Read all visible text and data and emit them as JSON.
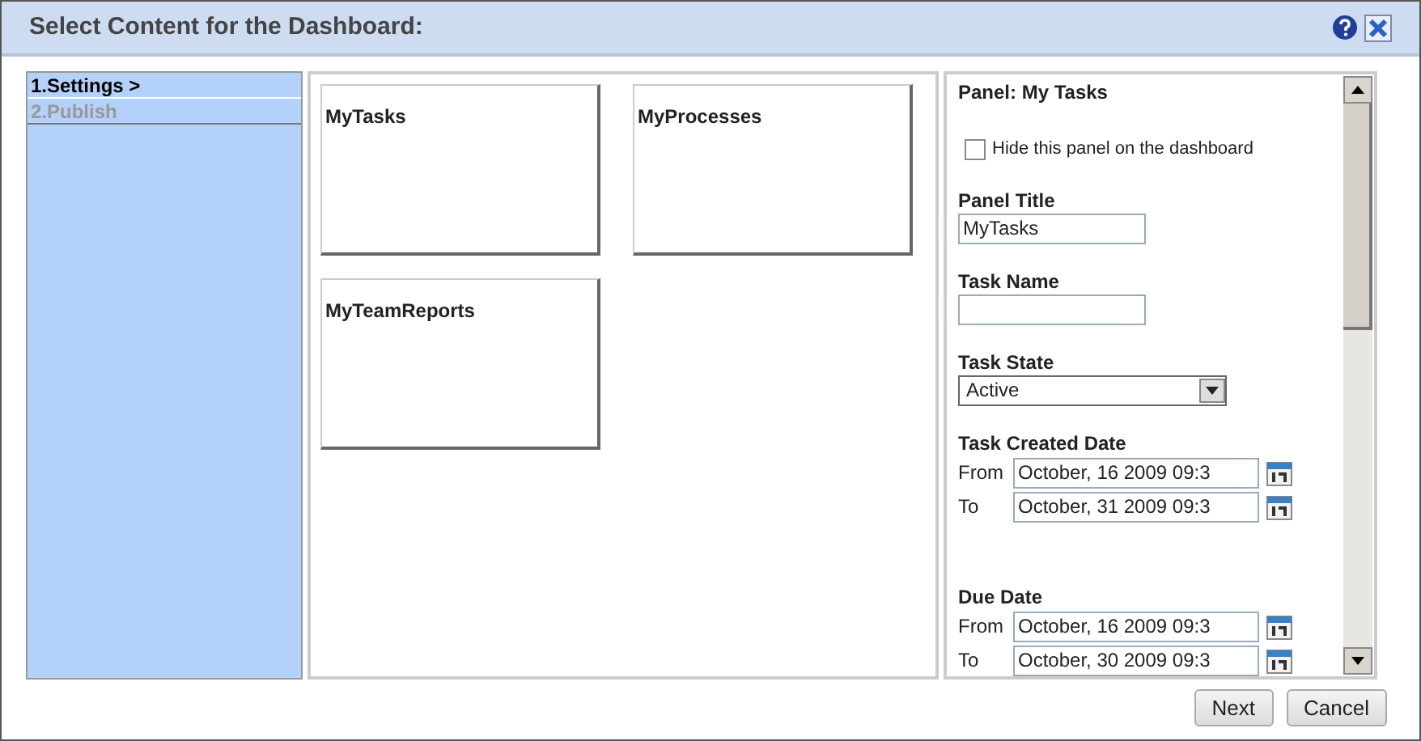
{
  "window": {
    "title": "Select Content for the Dashboard:"
  },
  "steps": [
    {
      "label": "1.Settings >",
      "selected": true
    },
    {
      "label": "2.Publish",
      "selected": false
    }
  ],
  "panels": [
    {
      "title": "MyTasks"
    },
    {
      "title": "MyProcesses"
    },
    {
      "title": "MyTeamReports"
    }
  ],
  "form": {
    "heading": "Panel: My Tasks",
    "fields": [
      {
        "kind": "checkbox",
        "label": "Hide this panel on the dashboard",
        "checked": false
      },
      {
        "kind": "text",
        "label": "Panel Title",
        "value": "MyTasks"
      },
      {
        "kind": "text",
        "label": "Task Name"
      },
      {
        "kind": "select",
        "label": "Task State",
        "value": "Active"
      },
      {
        "kind": "daterange",
        "label": "Task Created Date",
        "from_label": "From",
        "from": "October, 16 2009 09:3",
        "to_label": "To",
        "to": "October, 31 2009 09:3"
      },
      {
        "kind": "daterange",
        "label": "Due Date",
        "from_label": "From",
        "from": "October, 16 2009 09:3",
        "to_label": "To",
        "to": "October, 30 2009 09:3"
      }
    ]
  },
  "buttons": [
    "Next",
    "Cancel"
  ]
}
